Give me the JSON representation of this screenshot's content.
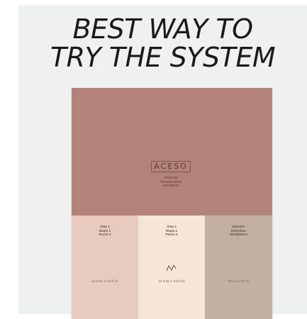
{
  "headline": {
    "line1": "BEST WAY TO",
    "line2": "TRY THE SYSTEM"
  },
  "product": {
    "brand": "ACESO",
    "kit_label": [
      "Client Kit",
      "Trousse client",
      "Kit cliente"
    ],
    "steps": [
      {
        "lines": [
          "Step 1",
          "Étape 1",
          "Passo 1"
        ],
        "volume": "14.3 mL ℮ 0.5 fl oz"
      },
      {
        "lines": [
          "Step 2",
          "Étape 2",
          "Passo 2"
        ],
        "volume": "14.3 mL ℮ 0.5 fl oz"
      },
      {
        "lines": [
          "Debrider",
          "Débrideur",
          "Sbrigliatore"
        ],
        "volume": "60 mL ℮ 2 fl oz"
      }
    ]
  },
  "colors": {
    "box": "#b38379",
    "panel_left": "#e8cbbe",
    "panel_center": "#f5e6d8",
    "panel_right": "#c3afa3"
  }
}
